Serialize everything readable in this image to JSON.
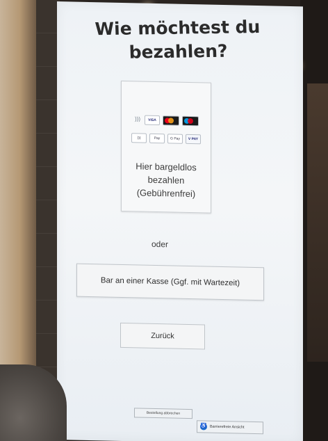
{
  "screen": {
    "title": "Wie möchtest du bezahlen?"
  },
  "card_option": {
    "logos_row1": [
      "contactless-icon",
      "visa-icon",
      "mastercard-icon",
      "maestro-icon"
    ],
    "logos_row2": [
      "contactless-icon",
      "apple-pay-icon",
      "google-pay-icon",
      "vpay-icon"
    ],
    "logo_labels": {
      "visa": "VISA",
      "apple_pay": "Pay",
      "google_pay": "G Pay",
      "vpay": "V PAY"
    },
    "text_line1": "Hier bargeldlos",
    "text_line2": "bezahlen",
    "text_line3": "(Gebührenfrei)"
  },
  "separator": "oder",
  "cash_option": {
    "label": "Bar an einer Kasse (Ggf. mit Wartezeit)"
  },
  "back_button": {
    "label": "Zurück"
  },
  "footer": {
    "cancel_order_label": "Bestellung abbrechen",
    "accessible_view_label": "Barrierefreie Ansicht",
    "colors": {
      "accessible_icon": "#1f6fd1"
    }
  }
}
